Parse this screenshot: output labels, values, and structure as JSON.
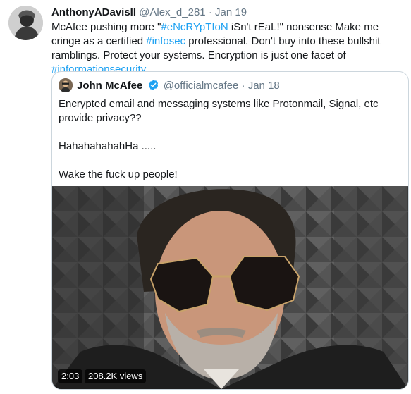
{
  "tweet": {
    "display_name": "AnthonyADavisII",
    "handle": "@Alex_d_281",
    "separator": "·",
    "date": "Jan 19",
    "text_segments": [
      {
        "text": "McAfee pushing more \"",
        "hashtag": false
      },
      {
        "text": "#eNcRYpTIoN",
        "hashtag": true
      },
      {
        "text": " iSn't rEaL!\" nonsense  Make me cringe as a certified ",
        "hashtag": false
      },
      {
        "text": "#infosec",
        "hashtag": true
      },
      {
        "text": " professional. Don't buy into these bullshit ramblings. Protect your systems. Encryption is just one facet of ",
        "hashtag": false
      },
      {
        "text": "#informationsecurity",
        "hashtag": true
      },
      {
        "text": ".",
        "hashtag": false
      }
    ]
  },
  "quoted": {
    "display_name": "John McAfee",
    "verified_icon": "verified-badge-icon",
    "handle": "@officialmcafee",
    "separator": "·",
    "date": "Jan 18",
    "paragraphs": [
      "Encrypted email and messaging systems like Protonmail, Signal, etc provide privacy??",
      "HahahahahahHa .....",
      "Wake the fuck up people!"
    ],
    "video": {
      "duration": "2:03",
      "views": "208.2K views"
    }
  },
  "colors": {
    "hashtag": "#1da1f2",
    "muted": "#657786",
    "verified": "#1da1f2",
    "border": "#ccd6dd"
  }
}
